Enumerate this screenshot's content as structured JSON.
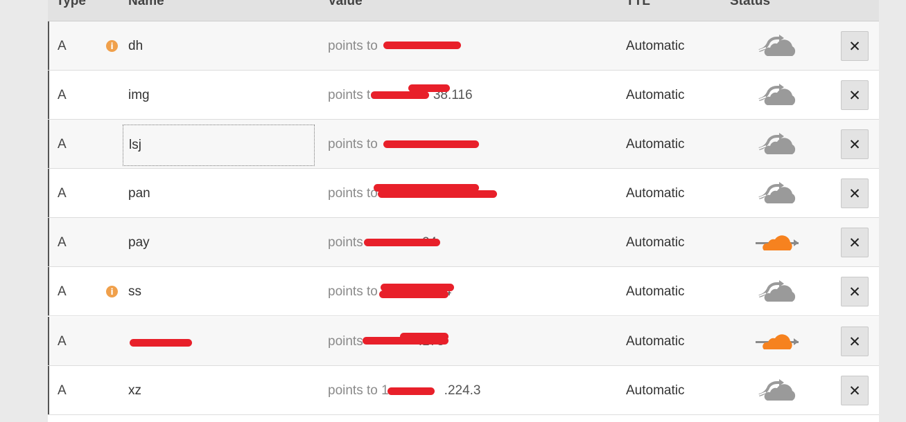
{
  "columns": {
    "type": "Type",
    "name": "Name",
    "value": "Value",
    "ttl": "TTL",
    "status": "Status"
  },
  "colors": {
    "proxied": "#f6821f",
    "dns_only": "#9a9a9a",
    "info": "#f0a04b"
  },
  "records": [
    {
      "type": "A",
      "name": "dh",
      "value_prefix": "points to",
      "value_tail": "",
      "ttl": "Automatic",
      "status": "dns-only",
      "info": true
    },
    {
      "type": "A",
      "name": "img",
      "value_prefix": "points to",
      "value_tail": "38.116",
      "ttl": "Automatic",
      "status": "dns-only",
      "info": false
    },
    {
      "type": "A",
      "name": "lsj",
      "value_prefix": "points to",
      "value_tail": "",
      "ttl": "Automatic",
      "status": "dns-only",
      "info": false
    },
    {
      "type": "A",
      "name": "pan",
      "value_prefix": "points to",
      "value_tail": "",
      "ttl": "Automatic",
      "status": "dns-only",
      "info": false
    },
    {
      "type": "A",
      "name": "pay",
      "value_prefix": "points",
      "value_tail": ".24",
      "ttl": "Automatic",
      "status": "proxied",
      "info": false
    },
    {
      "type": "A",
      "name": "ss",
      "value_prefix": "points to",
      "value_tail": ".24",
      "ttl": "Automatic",
      "status": "dns-only",
      "info": true
    },
    {
      "type": "A",
      "name": "",
      "value_prefix": "points",
      "value_tail": ".178",
      "ttl": "Automatic",
      "status": "proxied",
      "info": false
    },
    {
      "type": "A",
      "name": "xz",
      "value_prefix": "points to 1",
      "value_tail": ".224.3",
      "ttl": "Automatic",
      "status": "dns-only",
      "info": false
    }
  ],
  "delete_label": "✕",
  "info_label": "i"
}
